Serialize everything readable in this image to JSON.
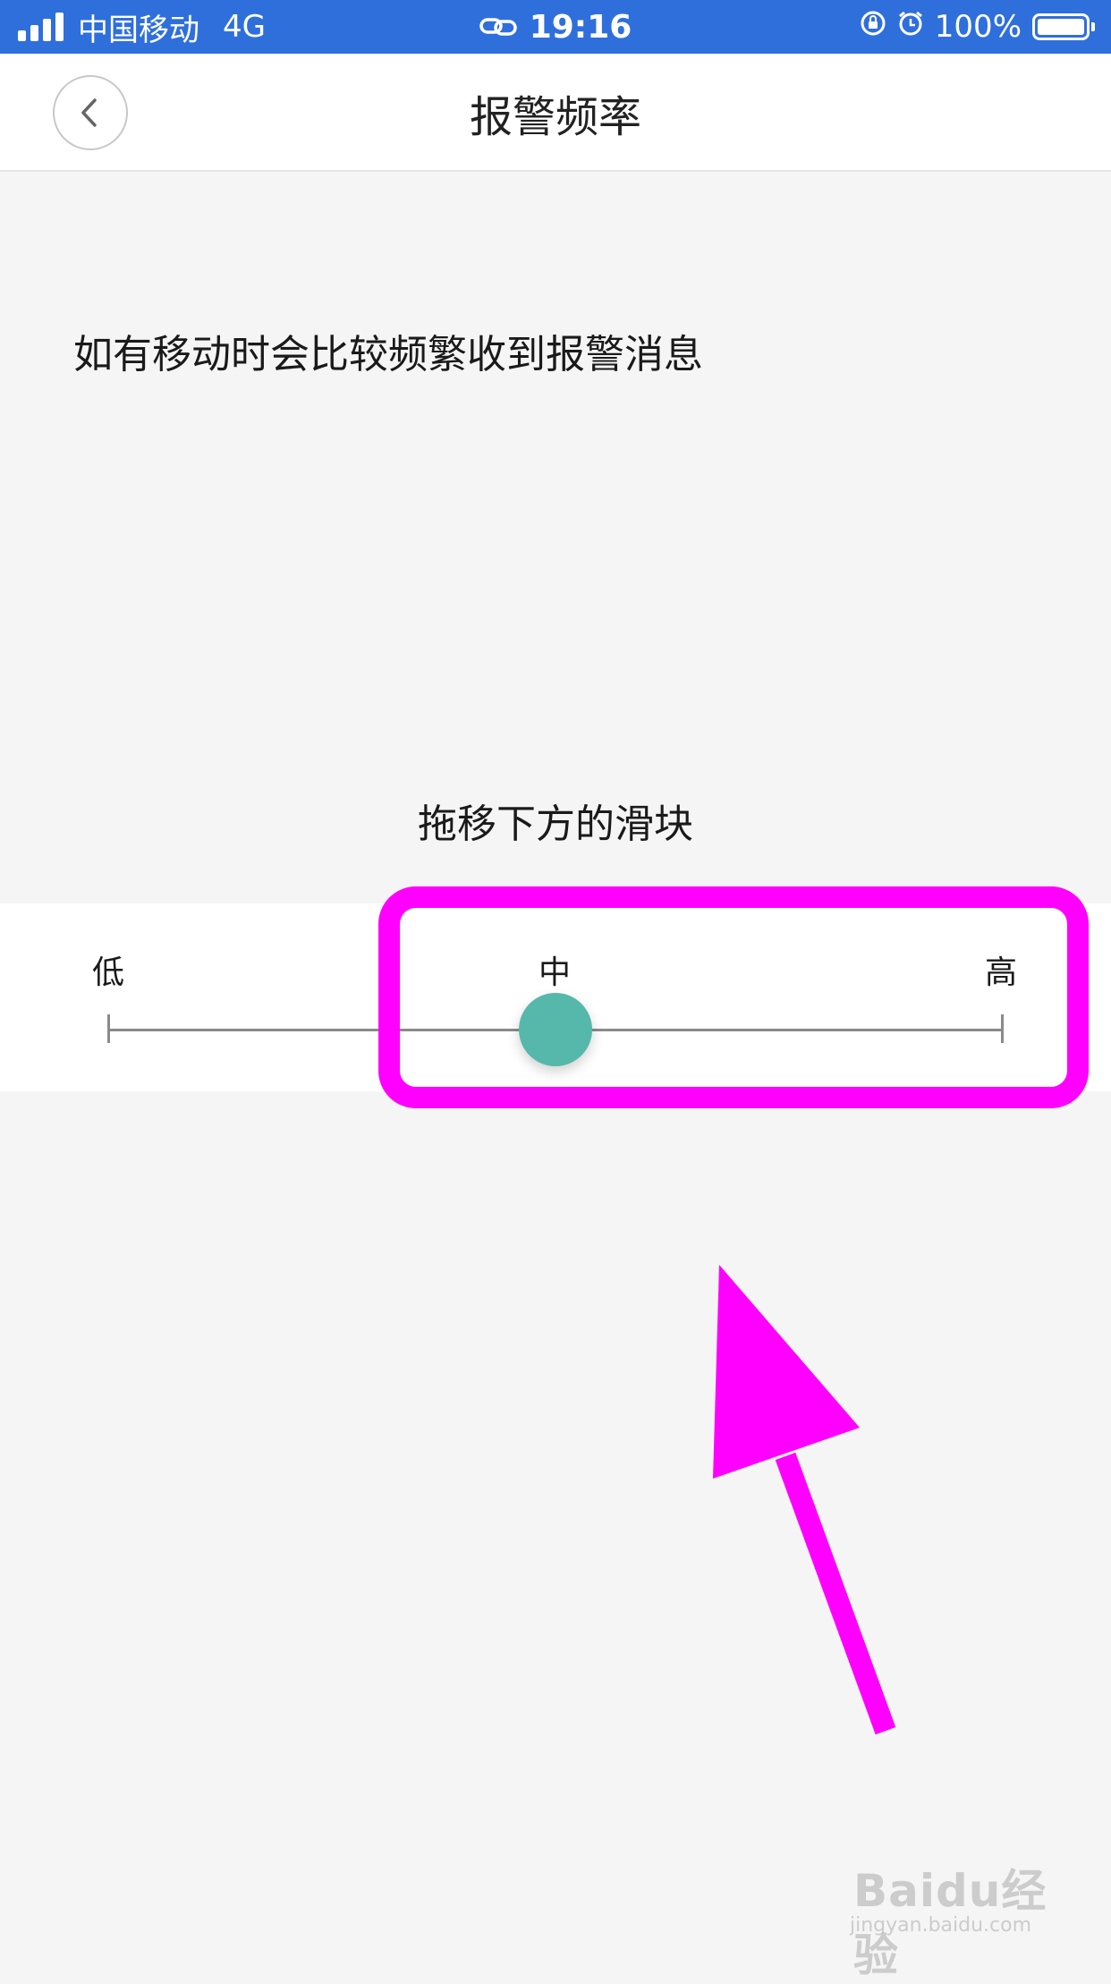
{
  "status_bar": {
    "carrier": "中国移动",
    "network": "4G",
    "time": "19:16",
    "battery": "100%",
    "icons": [
      "signal-icon",
      "link-icon",
      "rotation-lock-icon",
      "alarm-icon",
      "battery-icon"
    ]
  },
  "nav": {
    "title": "报警频率",
    "back_icon": "chevron-left-icon"
  },
  "description": "如有移动时会比较频繁收到报警消息",
  "instruction": "拖移下方的滑块",
  "slider": {
    "labels": [
      "低",
      "中",
      "高"
    ],
    "selected": "中",
    "value_fraction": 0.5
  },
  "annotation": {
    "color": "#ff00ff"
  },
  "watermark": {
    "brand": "Baidu经验",
    "url": "jingyan.baidu.com"
  },
  "colors": {
    "status_bar": "#2f6fdc",
    "thumb": "#55b8aa",
    "background": "#f5f5f5"
  }
}
